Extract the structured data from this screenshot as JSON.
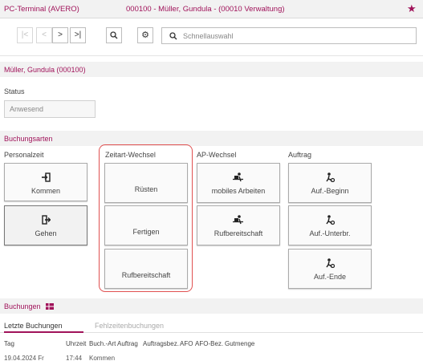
{
  "header": {
    "app_title": "PC-Terminal (AVERO)",
    "person_info": "000100 - Müller, Gundula - (00010 Verwaltung)",
    "favorite_icon": "star-icon"
  },
  "toolbar": {
    "first_label": "|<",
    "prev_label": "<",
    "next_label": ">",
    "last_label": ">|",
    "search_placeholder": "Schnellauswahl"
  },
  "person": {
    "heading": "Müller, Gundula (000100)",
    "status_label": "Status",
    "status_value": "Anwesend"
  },
  "booking_types": {
    "heading": "Buchungsarten",
    "columns": {
      "personalzeit": "Personalzeit",
      "zeitart": "Zeitart-Wechsel",
      "ap": "AP-Wechsel",
      "auftrag": "Auftrag"
    },
    "personalzeit": {
      "kommen": "Kommen",
      "gehen": "Gehen"
    },
    "zeitart": {
      "ruesten": "Rüsten",
      "fertigen": "Fertigen",
      "rufbereitschaft": "Rufbereitschaft"
    },
    "ap": {
      "mobiles": "mobiles Arbeiten",
      "rufbereitschaft": "Rufbereitschaft"
    },
    "auftrag": {
      "beginn": "Auf.-Beginn",
      "unterbr": "Auf.-Unterbr.",
      "ende": "Auf.-Ende"
    },
    "highlight_color": "#e05050"
  },
  "bookings": {
    "heading": "Buchungen",
    "tabs": {
      "latest": "Letzte Buchungen",
      "absence": "Fehlzeitenbuchungen"
    },
    "columns": {
      "tag": "Tag",
      "uhrzeit": "Uhrzeit",
      "buchart": "Buch.-Art",
      "auftrag": "Auftrag",
      "auftragsbez": "Auftragsbez.",
      "afo": "AFO",
      "afobez": "AFO-Bez.",
      "gutmenge": "Gutmenge"
    },
    "row1": {
      "tag": "19.04.2024 Fr",
      "uhrzeit": "17:44",
      "buchart": "Kommen"
    }
  },
  "colors": {
    "accent": "#a0135a",
    "band": "#f2f2f2"
  }
}
